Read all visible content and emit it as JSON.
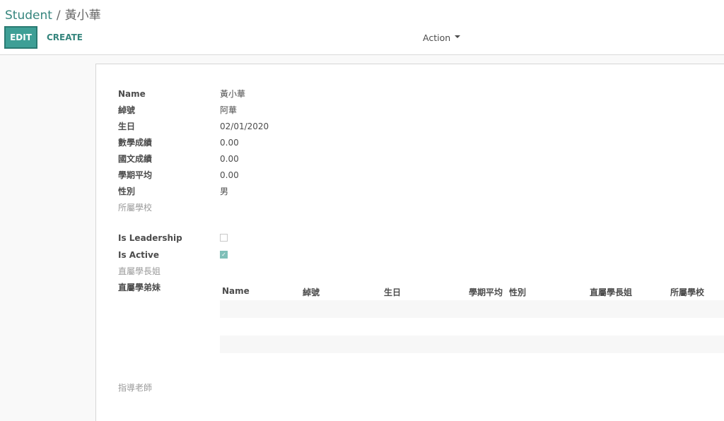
{
  "breadcrumb": {
    "parent": "Student",
    "separator": "/",
    "current": "黃小華"
  },
  "toolbar": {
    "edit_label": "EDIT",
    "create_label": "CREATE",
    "action_label": "Action"
  },
  "form": {
    "name_label": "Name",
    "name_value": "黃小華",
    "nickname_label": "綽號",
    "nickname_value": "阿華",
    "birthday_label": "生日",
    "birthday_value": "02/01/2020",
    "math_label": "數學成績",
    "math_value": "0.00",
    "chinese_label": "國文成績",
    "chinese_value": "0.00",
    "avg_label": "學期平均",
    "avg_value": "0.00",
    "gender_label": "性別",
    "gender_value": "男",
    "school_label": "所屬學校",
    "leadership_label": "Is Leadership",
    "leadership_checked": false,
    "active_label": "Is Active",
    "active_checked": true,
    "senior_label": "直屬學長姐",
    "junior_label": "直屬學弟妹",
    "teacher_label": "指導老師"
  },
  "juniors_table": {
    "columns": [
      "Name",
      "綽號",
      "生日",
      "學期平均",
      "性別",
      "直屬學長姐",
      "所屬學校"
    ],
    "rows": []
  },
  "colors": {
    "accent": "#3e9f96",
    "link": "#35857d",
    "muted_label": "#9a9a9a"
  }
}
